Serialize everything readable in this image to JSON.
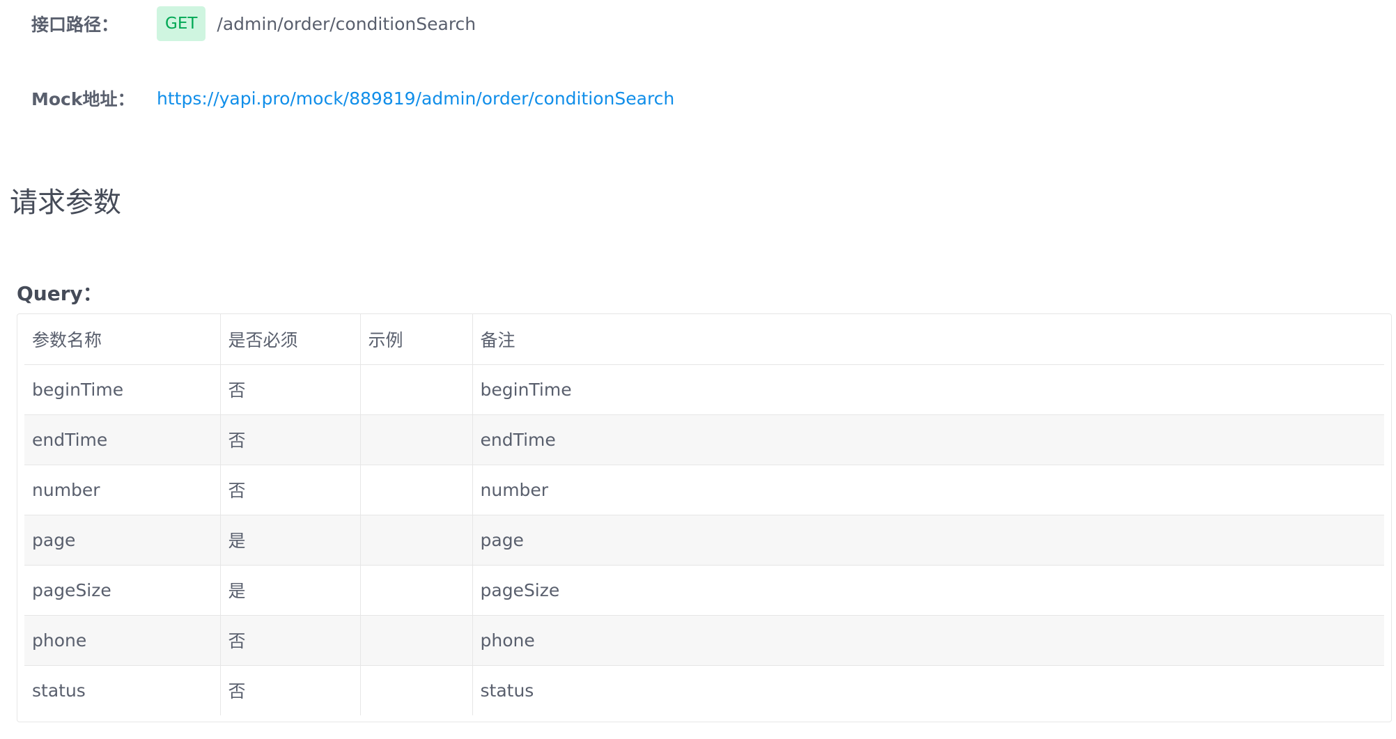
{
  "interface": {
    "path_label": "接口路径：",
    "method": "GET",
    "path": "/admin/order/conditionSearch",
    "mock_label": "Mock地址：",
    "mock_url": "https://yapi.pro/mock/889819/admin/order/conditionSearch"
  },
  "request": {
    "section_title": "请求参数",
    "query_label": "Query：",
    "columns": [
      "参数名称",
      "是否必须",
      "示例",
      "备注"
    ],
    "rows": [
      {
        "name": "beginTime",
        "required": "否",
        "example": "",
        "note": "beginTime"
      },
      {
        "name": "endTime",
        "required": "否",
        "example": "",
        "note": "endTime"
      },
      {
        "name": "number",
        "required": "否",
        "example": "",
        "note": "number"
      },
      {
        "name": "page",
        "required": "是",
        "example": "",
        "note": "page"
      },
      {
        "name": "pageSize",
        "required": "是",
        "example": "",
        "note": "pageSize"
      },
      {
        "name": "phone",
        "required": "否",
        "example": "",
        "note": "phone"
      },
      {
        "name": "status",
        "required": "否",
        "example": "",
        "note": "status"
      }
    ]
  },
  "colors": {
    "method_bg": "#cff5e0",
    "method_text": "#00a854",
    "link": "#108ee9",
    "stripe": "#f7f7f7"
  }
}
